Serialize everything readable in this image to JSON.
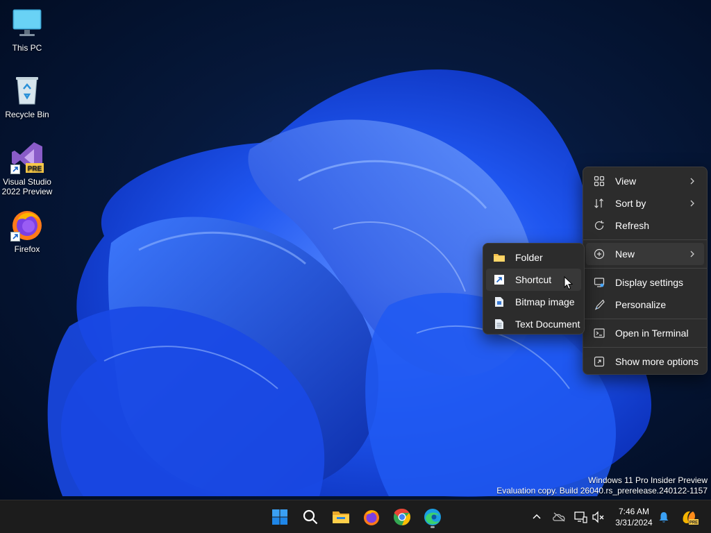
{
  "desktop": {
    "icons": [
      {
        "label": "This PC",
        "icon": "monitor-icon"
      },
      {
        "label": "Recycle Bin",
        "icon": "recycle-bin-icon"
      },
      {
        "label_line1": "Visual Studio",
        "label_line2": "2022 Preview",
        "badge": "PRE",
        "icon": "visual-studio-icon"
      },
      {
        "label": "Firefox",
        "icon": "firefox-icon"
      }
    ]
  },
  "context_menu": {
    "items": [
      {
        "label": "View",
        "icon": "grid-icon",
        "has_submenu": true
      },
      {
        "label": "Sort by",
        "icon": "sort-icon",
        "has_submenu": true
      },
      {
        "label": "Refresh",
        "icon": "refresh-icon"
      },
      {
        "label": "New",
        "icon": "plus-circle-icon",
        "has_submenu": true,
        "highlighted": true
      },
      {
        "label": "Display settings",
        "icon": "display-icon"
      },
      {
        "label": "Personalize",
        "icon": "brush-icon"
      },
      {
        "label": "Open in Terminal",
        "icon": "terminal-icon"
      },
      {
        "label": "Show more options",
        "icon": "expand-icon"
      }
    ]
  },
  "new_submenu": {
    "items": [
      {
        "label": "Folder",
        "icon": "folder-icon"
      },
      {
        "label": "Shortcut",
        "icon": "shortcut-icon",
        "highlighted": true
      },
      {
        "label": "Bitmap image",
        "icon": "bitmap-icon"
      },
      {
        "label": "Text Document",
        "icon": "text-document-icon"
      }
    ]
  },
  "watermark": {
    "line1": "Windows 11 Pro Insider Preview",
    "line2": "Evaluation copy. Build 26040.rs_prerelease.240122-1157"
  },
  "taskbar": {
    "apps": [
      "start-icon",
      "search-icon",
      "file-explorer-icon",
      "firefox-icon",
      "chrome-icon",
      "edge-icon"
    ],
    "clock": {
      "time": "7:46 AM",
      "date": "3/31/2024"
    },
    "tray": [
      "chevron-up-icon",
      "onedrive-icon",
      "network-icon",
      "volume-muted-icon",
      "notification-bell-icon",
      "copilot-icon"
    ],
    "tray_badge": "PRE"
  },
  "colors": {
    "accent": "#0078d4",
    "menu_bg": "#2c2c2c",
    "taskbar_bg": "#1c1c1c"
  }
}
